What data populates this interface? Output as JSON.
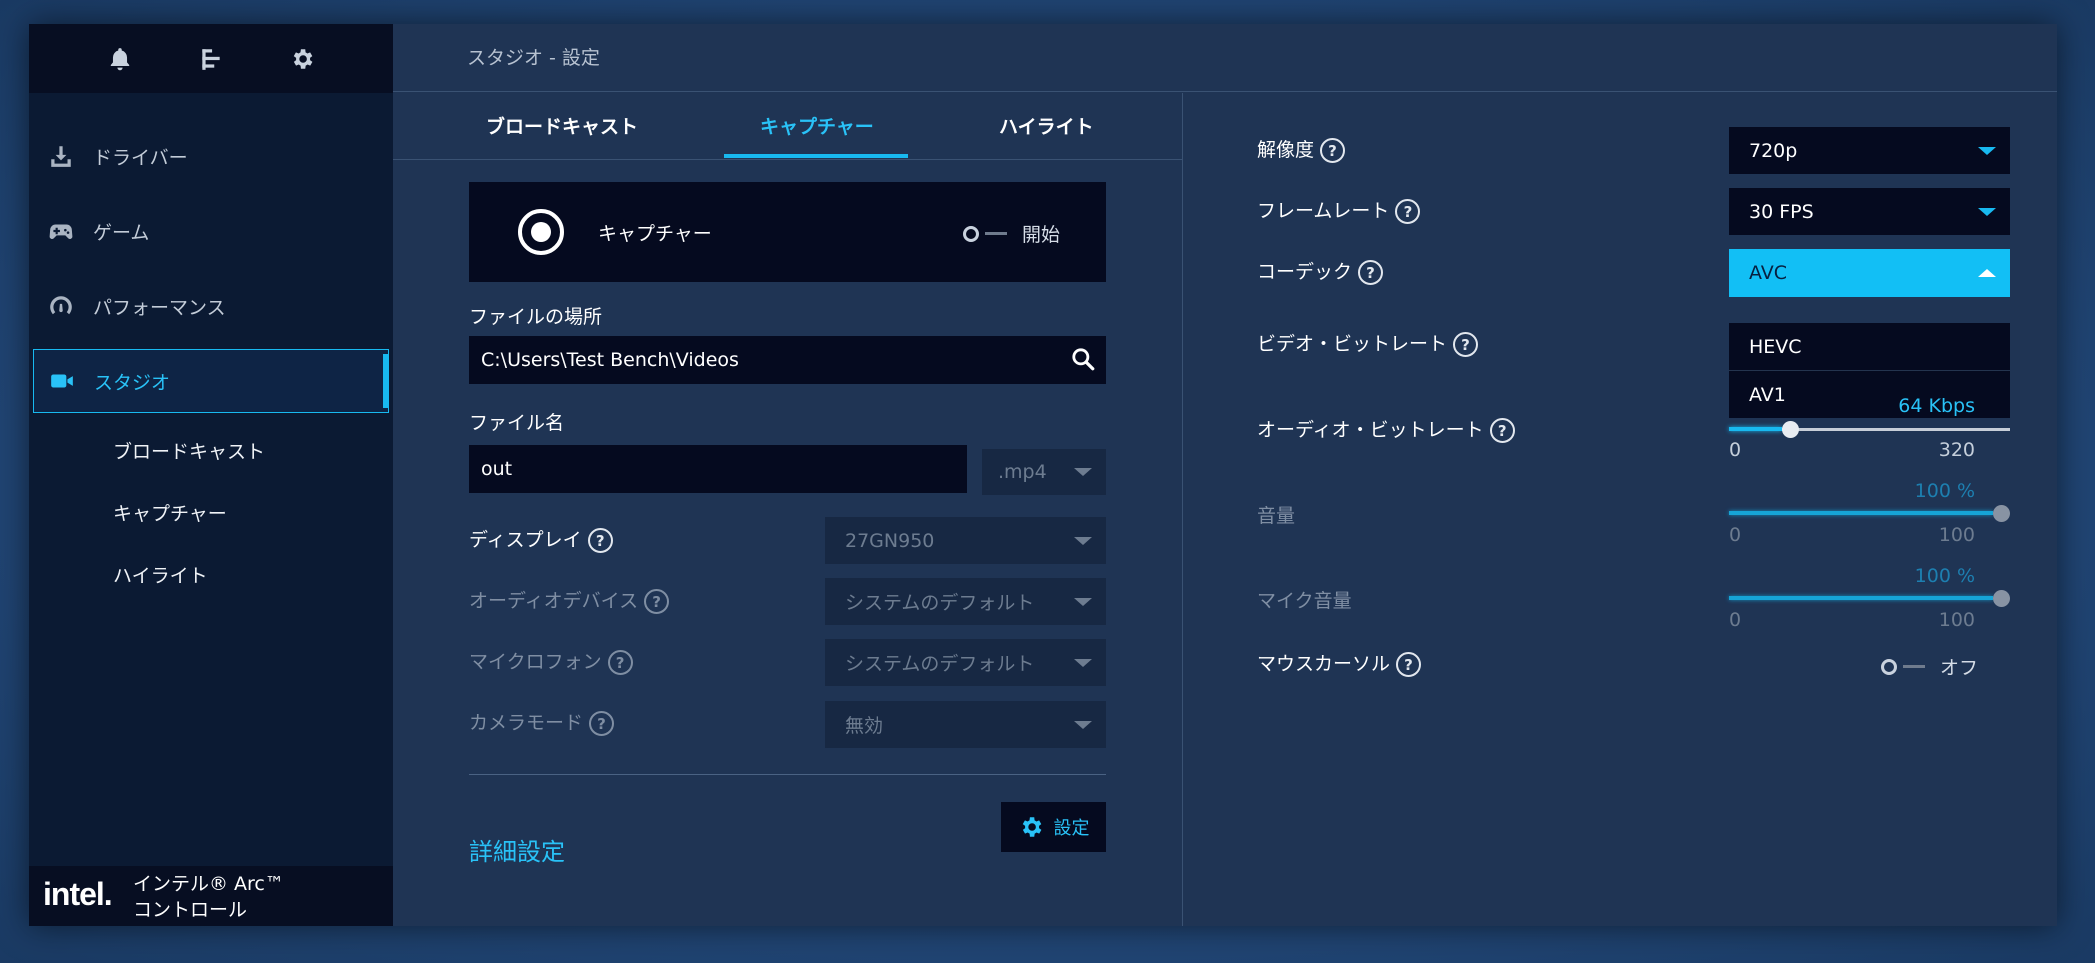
{
  "header": {
    "title": "スタジオ - 設定"
  },
  "sidebar": {
    "top_icons": [
      "bell-icon",
      "menu-icon",
      "gear-icon"
    ],
    "items": [
      {
        "label": "ドライバー",
        "icon": "download-icon"
      },
      {
        "label": "ゲーム",
        "icon": "gamepad-icon"
      },
      {
        "label": "パフォーマンス",
        "icon": "gauge-icon"
      },
      {
        "label": "スタジオ",
        "icon": "video-camera-icon",
        "active": true
      }
    ],
    "sub_items": [
      "ブロードキャスト",
      "キャプチャー",
      "ハイライト"
    ],
    "brand": {
      "logo": "intel.",
      "line1": "インテル® Arc™",
      "line2": "コントロール"
    }
  },
  "tabs": [
    {
      "label": "ブロードキャスト"
    },
    {
      "label": "キャプチャー",
      "active": true
    },
    {
      "label": "ハイライト"
    }
  ],
  "capture": {
    "label": "キャプチャー",
    "toggle_label": "開始",
    "file_location_label": "ファイルの場所",
    "file_location_value": "C:\\Users\\Test Bench\\Videos",
    "file_name_label": "ファイル名",
    "file_name_value": "out",
    "file_ext": ".mp4",
    "display_label": "ディスプレイ",
    "display_value": "27GN950",
    "audio_device_label": "オーディオデバイス",
    "audio_device_value": "システムのデフォルト",
    "microphone_label": "マイクロフォン",
    "microphone_value": "システムのデフォルト",
    "camera_mode_label": "カメラモード",
    "camera_mode_value": "無効",
    "advanced_label": "詳細設定",
    "settings_button": "設定"
  },
  "right": {
    "resolution_label": "解像度",
    "resolution_value": "720p",
    "framerate_label": "フレームレート",
    "framerate_value": "30 FPS",
    "codec_label": "コーデック",
    "codec_value": "AVC",
    "codec_options": [
      "HEVC",
      "AV1"
    ],
    "video_bitrate_label": "ビデオ・ビットレート",
    "audio_bitrate_label": "オーディオ・ビットレート",
    "audio_bitrate": {
      "value_text": "64 Kbps",
      "min": "0",
      "max": "320",
      "fraction": 0.2
    },
    "volume_label": "音量",
    "volume": {
      "value_text": "100 %",
      "min": "0",
      "max": "100",
      "fraction": 1.0
    },
    "mic_volume_label": "マイク音量",
    "mic_volume": {
      "value_text": "100 %",
      "min": "0",
      "max": "100",
      "fraction": 1.0
    },
    "mouse_cursor_label": "マウスカーソル",
    "mouse_cursor_toggle": "オフ"
  },
  "help_mark": "?",
  "colors": {
    "accent": "#18b9f0",
    "panel": "#1f3454",
    "sidebar": "#0b1a33",
    "field": "#050a1f"
  }
}
